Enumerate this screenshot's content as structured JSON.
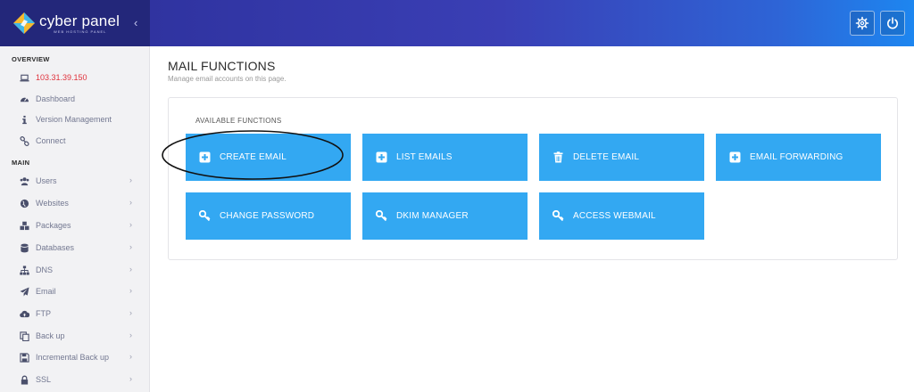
{
  "brand": {
    "name": "cyber panel",
    "tagline": "WEB HOSTING PANEL"
  },
  "header": {
    "collapse": "‹",
    "settings_icon": "gear-icon",
    "power_icon": "power-icon"
  },
  "sidebar": {
    "overview_heading": "OVERVIEW",
    "overview_items": [
      {
        "label": "103.31.39.150",
        "icon": "laptop-icon"
      },
      {
        "label": "Dashboard",
        "icon": "tachometer-icon"
      },
      {
        "label": "Version Management",
        "icon": "info-icon"
      },
      {
        "label": "Connect",
        "icon": "link-icon"
      }
    ],
    "main_heading": "MAIN",
    "main_items": [
      {
        "label": "Users",
        "icon": "users-icon"
      },
      {
        "label": "Websites",
        "icon": "globe-icon"
      },
      {
        "label": "Packages",
        "icon": "cubes-icon"
      },
      {
        "label": "Databases",
        "icon": "database-icon"
      },
      {
        "label": "DNS",
        "icon": "sitemap-icon"
      },
      {
        "label": "Email",
        "icon": "paper-plane-icon"
      },
      {
        "label": "FTP",
        "icon": "cloud-upload-icon"
      },
      {
        "label": "Back up",
        "icon": "copy-icon"
      },
      {
        "label": "Incremental Back up",
        "icon": "save-icon"
      },
      {
        "label": "SSL",
        "icon": "lock-icon"
      }
    ],
    "chevron": "›"
  },
  "main": {
    "title": "MAIL FUNCTIONS",
    "subtitle": "Manage email accounts on this page.",
    "panel_heading": "AVAILABLE FUNCTIONS",
    "functions": [
      {
        "label": "CREATE EMAIL",
        "icon": "plus-square-icon"
      },
      {
        "label": "LIST EMAILS",
        "icon": "plus-square-icon"
      },
      {
        "label": "DELETE EMAIL",
        "icon": "trash-icon"
      },
      {
        "label": "EMAIL FORWARDING",
        "icon": "plus-square-icon"
      },
      {
        "label": "CHANGE PASSWORD",
        "icon": "key-icon"
      },
      {
        "label": "DKIM MANAGER",
        "icon": "key-icon"
      },
      {
        "label": "ACCESS WEBMAIL",
        "icon": "key-icon"
      }
    ]
  },
  "colors": {
    "accent": "#33a8f2",
    "header_start": "#2b2e97",
    "header_end": "#1d86f0",
    "ip_text": "#e0313b"
  }
}
